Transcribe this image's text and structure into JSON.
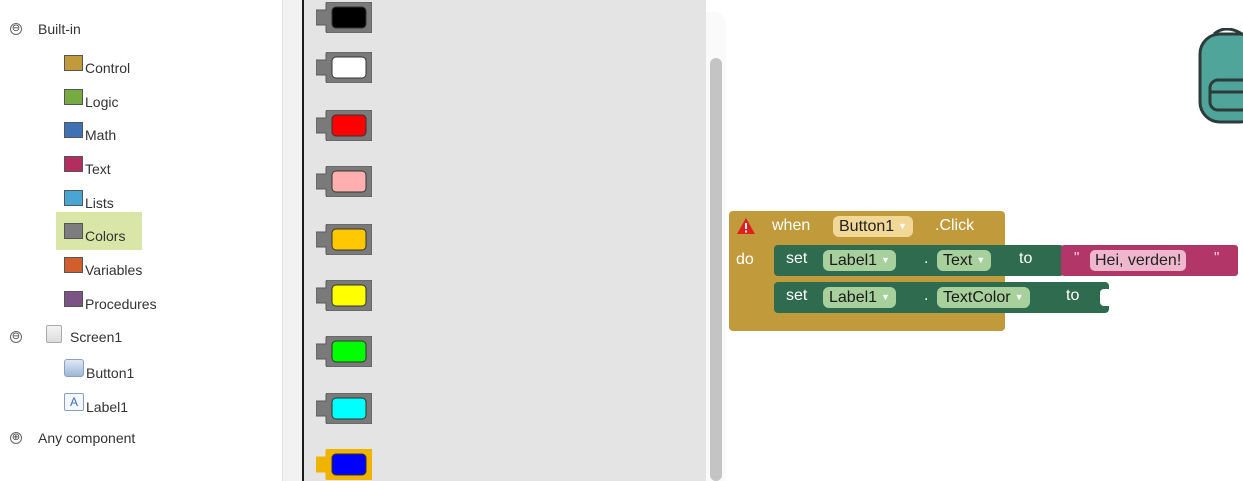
{
  "tree": {
    "builtin": {
      "toggle": "⊖",
      "label": "Built-in"
    },
    "categories": [
      {
        "label": "Control",
        "color": "#c09a3b"
      },
      {
        "label": "Logic",
        "color": "#77ab41"
      },
      {
        "label": "Math",
        "color": "#3f71b5"
      },
      {
        "label": "Text",
        "color": "#b32d5e"
      },
      {
        "label": "Lists",
        "color": "#49a6d4"
      },
      {
        "label": "Colors",
        "color": "#7d7d7d"
      },
      {
        "label": "Variables",
        "color": "#d05f2d"
      },
      {
        "label": "Procedures",
        "color": "#7c5385"
      }
    ],
    "selected_category": "Colors",
    "screen": {
      "toggle": "⊖",
      "label": "Screen1"
    },
    "components": [
      {
        "label": "Button1",
        "icon": "button-component-icon"
      },
      {
        "label": "Label1",
        "icon": "label-component-icon",
        "glyph": "A"
      }
    ],
    "any_component": {
      "toggle": "⊕",
      "label": "Any component"
    }
  },
  "flyout": {
    "colors": [
      "#000000",
      "#ffffff",
      "#ff0000",
      "#ffafaf",
      "#ffc800",
      "#ffff00",
      "#00ff00",
      "#00ffff",
      "#0000ff"
    ],
    "selected_index": 8
  },
  "workspace": {
    "event_block": {
      "when": "when",
      "component": "Button1",
      "event": ".Click",
      "do": "do",
      "warning_icon": "warning-icon"
    },
    "statements": [
      {
        "set": "set",
        "component": "Label1",
        "dot": ".",
        "property": "Text",
        "to": "to",
        "value": "Hei, verden!"
      },
      {
        "set": "set",
        "component": "Label1",
        "dot": ".",
        "property": "TextColor",
        "to": "to"
      }
    ],
    "quote": "\"",
    "dropdown_arrow": "▼",
    "backpack_icon": "backpack-icon"
  }
}
